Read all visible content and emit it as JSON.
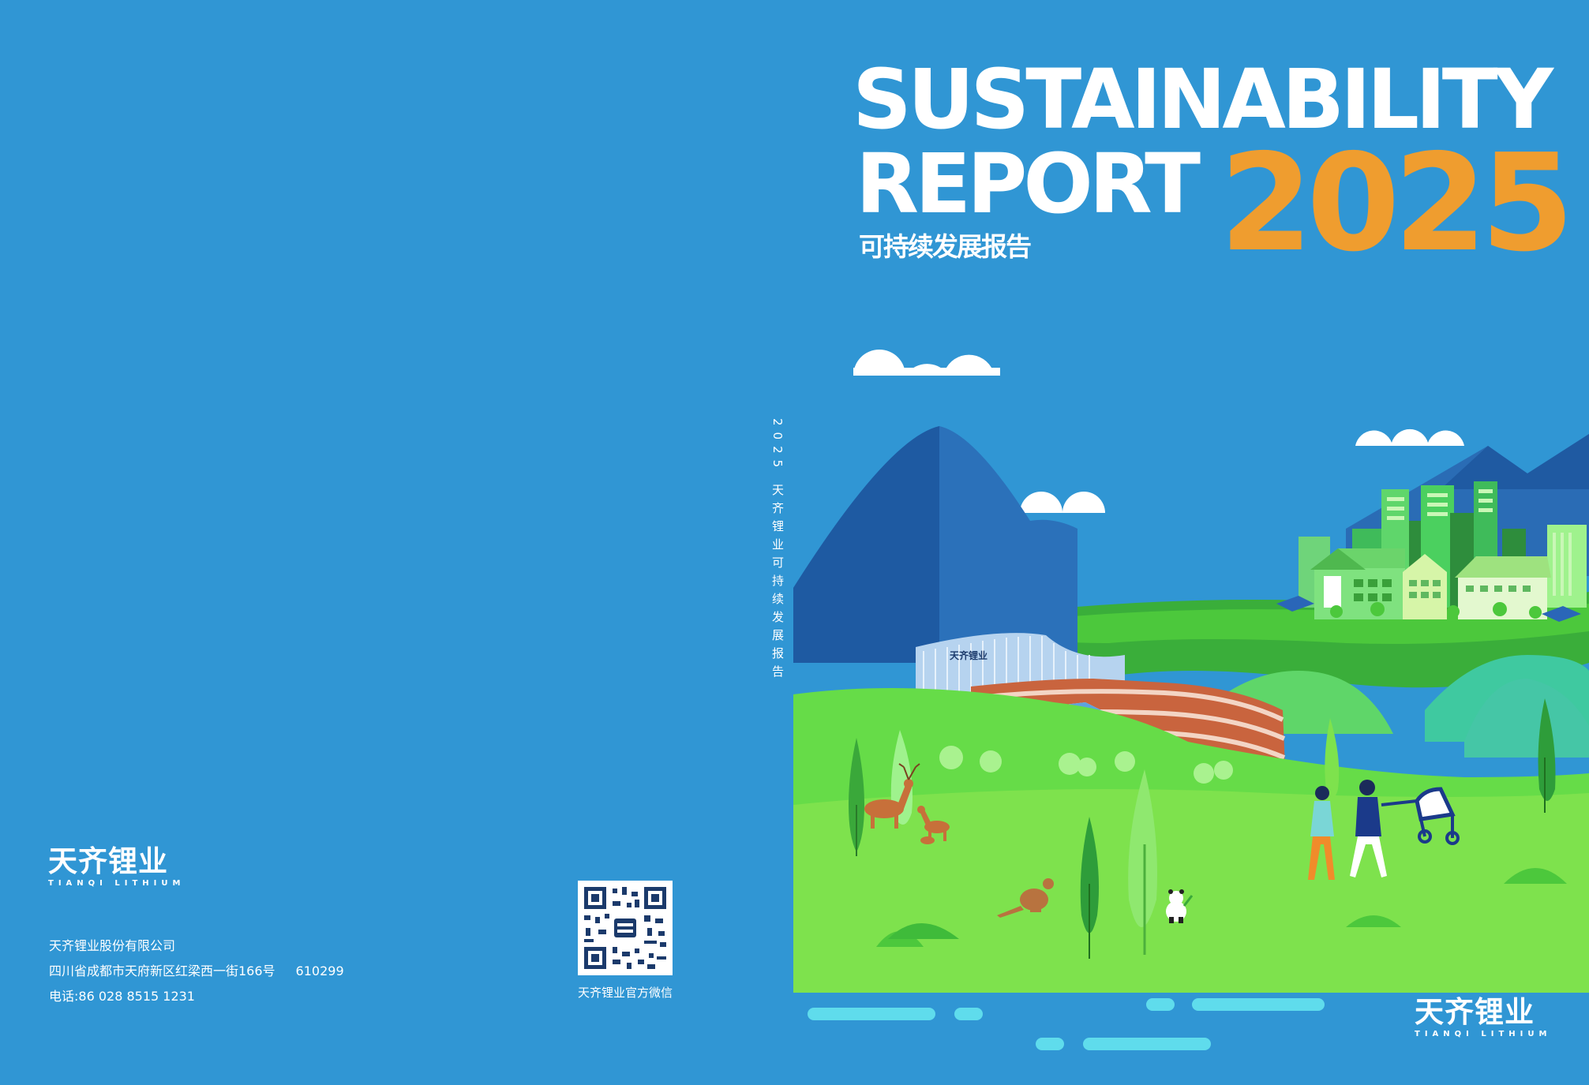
{
  "back_cover": {
    "logo_cn": "天齐锂业",
    "logo_en": "TIANQI LITHIUM",
    "company": "天齐锂业股份有限公司",
    "address": "四川省成都市天府新区红梁西一街166号",
    "postcode": "610299",
    "phone": "电话:86 028 8515 1231",
    "qr_caption": "天齐锂业官方微信"
  },
  "spine": {
    "text": "2025 天齐锂业可持续发展报告"
  },
  "front_cover": {
    "title_line1": "SUSTAINABILITY",
    "title_line2": "REPORT",
    "title_cn": "可持续发展报告",
    "year": "2025",
    "logo_cn": "天齐锂业",
    "logo_en": "TIANQI LITHIUM",
    "building_sign": "天齐锂业"
  },
  "colors": {
    "background": "#3096d4",
    "year_orange": "#ef9d2f",
    "grass_light": "#7ee24d",
    "grass_mid": "#4cc83c",
    "mountain": "#2a6cb5",
    "water_stripe": "#5fdcec"
  }
}
